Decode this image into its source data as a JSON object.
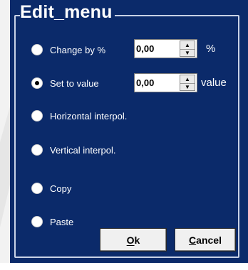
{
  "group": {
    "title": "Edit_menu"
  },
  "options": [
    {
      "label": "Change by %",
      "selected": false,
      "value": "0,00",
      "unit": "%"
    },
    {
      "label": "Set to value",
      "selected": true,
      "value": "0,00",
      "unit": "value"
    },
    {
      "label": "Horizontal interpol.",
      "selected": false
    },
    {
      "label": "Vertical interpol.",
      "selected": false
    },
    {
      "label": "Copy",
      "selected": false
    },
    {
      "label": "Paste",
      "selected": false
    }
  ],
  "buttons": {
    "ok": "Ok",
    "cancel": "Cancel"
  },
  "colors": {
    "panel": "#0b2a6a",
    "text": "#ffffff"
  },
  "icons": {
    "spin_up": "arrow-up-icon",
    "spin_down": "arrow-down-icon"
  }
}
